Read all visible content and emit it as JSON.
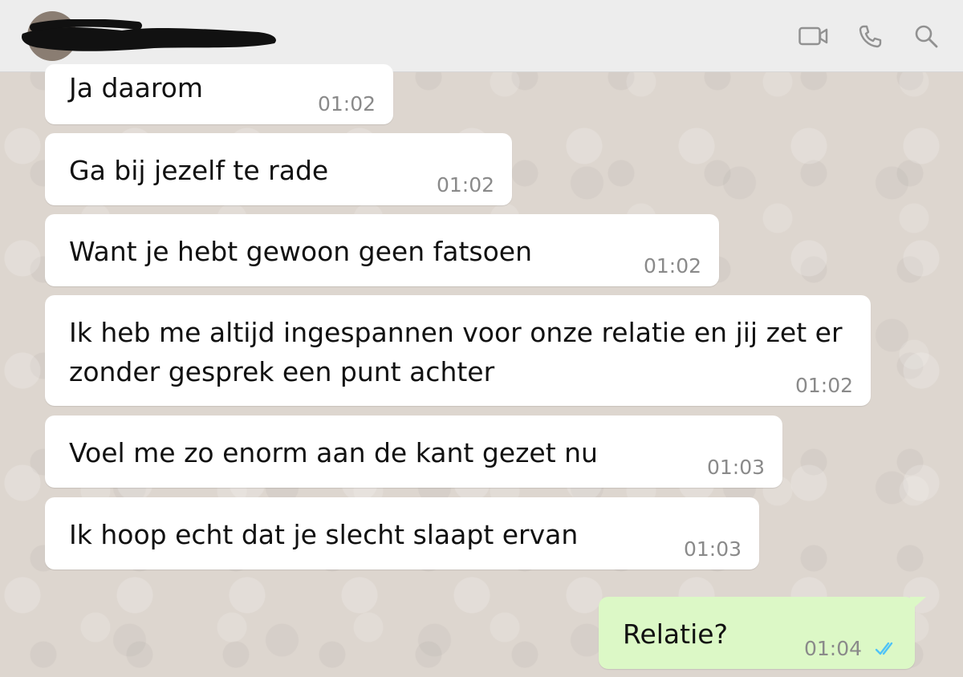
{
  "header": {
    "contact_name_redacted": true,
    "icons": [
      "video-call-icon",
      "voice-call-icon",
      "search-icon"
    ]
  },
  "messages": [
    {
      "direction": "in",
      "text": "Ja daarom",
      "time": "01:02"
    },
    {
      "direction": "in",
      "text": "Ga bij jezelf te rade",
      "time": "01:02"
    },
    {
      "direction": "in",
      "text": "Want je hebt gewoon geen fatsoen",
      "time": "01:02"
    },
    {
      "direction": "in",
      "text_line1": "Ik heb me altijd ingespannen voor onze relatie en jij zet er",
      "text_line2": "zonder gesprek een punt achter",
      "time": "01:02"
    },
    {
      "direction": "in",
      "text": "Voel me zo enorm aan de kant gezet nu",
      "time": "01:03"
    },
    {
      "direction": "in",
      "text": "Ik hoop echt dat je slecht slaapt ervan",
      "time": "01:03"
    },
    {
      "direction": "out",
      "text": "Relatie?",
      "time": "01:04",
      "status": "read"
    }
  ],
  "colors": {
    "header_bg": "#ededed",
    "chat_bg": "#ddd6cf",
    "incoming_bubble": "#ffffff",
    "outgoing_bubble": "#dcf8c6",
    "timestamp": "#8a8a8a",
    "read_ticks": "#4fc3f7",
    "icon": "#919191"
  }
}
